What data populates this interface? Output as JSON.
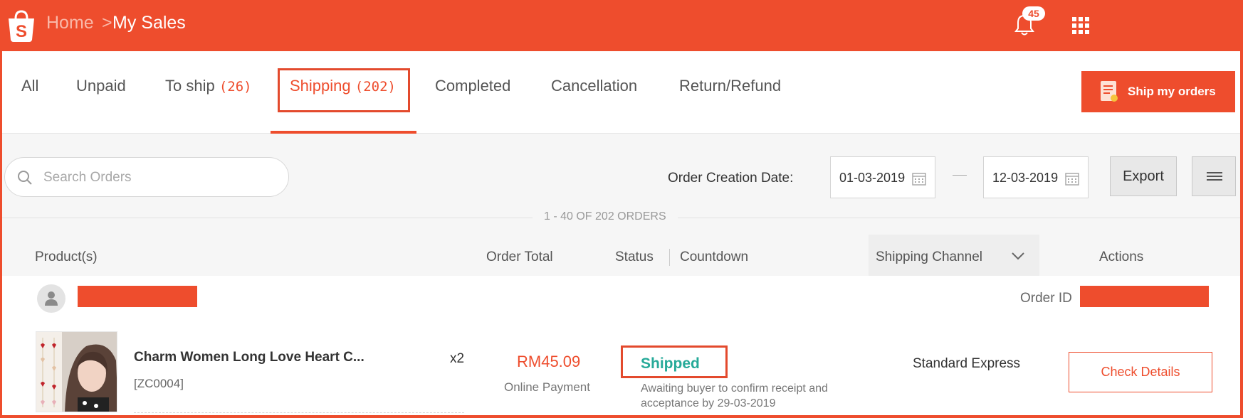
{
  "header": {
    "breadcrumb_home": "Home",
    "breadcrumb_sep": ">",
    "breadcrumb_current": "My Sales",
    "notification_count": "45",
    "brand_color": "#ee4d2d"
  },
  "tabs": [
    {
      "label": "All",
      "count": ""
    },
    {
      "label": "Unpaid",
      "count": ""
    },
    {
      "label": "To ship",
      "count": "(26)"
    },
    {
      "label": "Shipping",
      "count": "(202)"
    },
    {
      "label": "Completed",
      "count": ""
    },
    {
      "label": "Cancellation",
      "count": ""
    },
    {
      "label": "Return/Refund",
      "count": ""
    }
  ],
  "active_tab": "Shipping",
  "ship_button_label": "Ship my orders",
  "filter": {
    "search_placeholder": "Search Orders",
    "date_label": "Order Creation Date:",
    "date_from": "01-03-2019",
    "date_to": "12-03-2019",
    "export_label": "Export",
    "count_text": "1 - 40 OF 202 ORDERS"
  },
  "columns": {
    "product": "Product(s)",
    "total": "Order Total",
    "status": "Status",
    "countdown": "Countdown",
    "channel": "Shipping Channel",
    "actions": "Actions"
  },
  "order": {
    "order_id_label": "Order ID",
    "product_name": "Charm Women Long Love Heart C...",
    "sku": "[ZC0004]",
    "quantity": "x2",
    "total": "RM45.09",
    "payment": "Online Payment",
    "status": "Shipped",
    "status_note": "Awaiting buyer to confirm receipt and acceptance by 29-03-2019",
    "channel": "Standard Express",
    "action_label": "Check Details",
    "status_color": "#26aa99"
  }
}
